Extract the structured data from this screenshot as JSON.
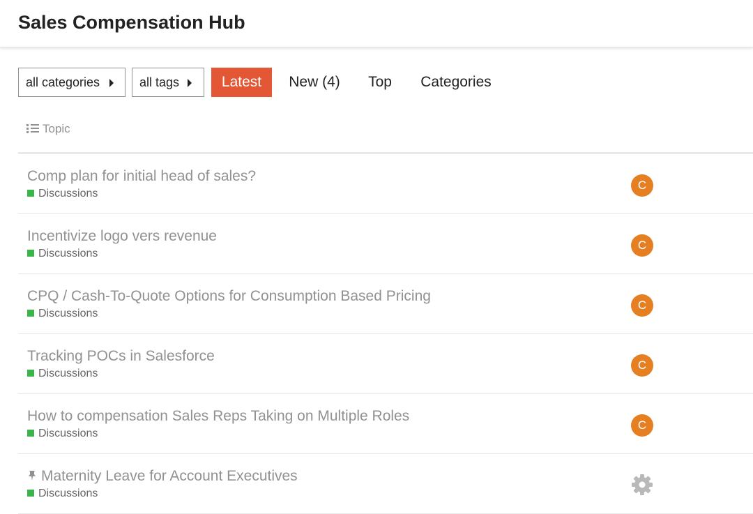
{
  "site": {
    "title": "Sales Compensation Hub"
  },
  "nav": {
    "categories_dropdown": "all categories",
    "tags_dropdown": "all tags",
    "tabs": [
      {
        "label": "Latest",
        "active": true
      },
      {
        "label": "New (4)",
        "active": false
      },
      {
        "label": "Top",
        "active": false
      },
      {
        "label": "Categories",
        "active": false
      }
    ]
  },
  "table": {
    "topic_header": "Topic",
    "header_icon": "list-icon"
  },
  "topics": [
    {
      "title": "Comp plan for initial head of sales?",
      "category": "Discussions",
      "poster": "C",
      "pinned": false
    },
    {
      "title": "Incentivize logo vers revenue",
      "category": "Discussions",
      "poster": "C",
      "pinned": false
    },
    {
      "title": "CPQ / Cash-To-Quote Options for Consumption Based Pricing",
      "category": "Discussions",
      "poster": "C",
      "pinned": false
    },
    {
      "title": "Tracking POCs in Salesforce",
      "category": "Discussions",
      "poster": "C",
      "pinned": false
    },
    {
      "title": "How to compensation Sales Reps Taking on Multiple Roles",
      "category": "Discussions",
      "poster": "C",
      "pinned": false
    },
    {
      "title": "Maternity Leave for Account Executives",
      "category": "Discussions",
      "poster_icon": "gear-icon",
      "pinned": true
    }
  ],
  "colors": {
    "accent": "#e45735",
    "avatar": "#e67e22",
    "category_discussions": "#3ab54a",
    "muted_text": "#919191",
    "gear": "#b9b9b9"
  }
}
